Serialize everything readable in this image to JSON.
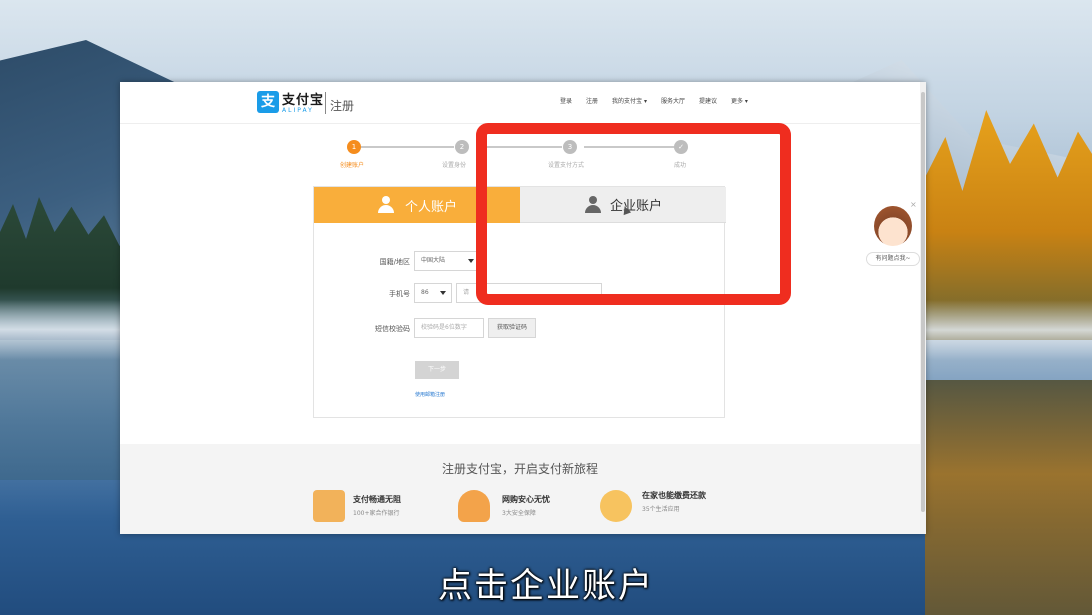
{
  "header": {
    "logo_mark": "支",
    "logo_text": "支付宝",
    "logo_sub": "ALIPAY",
    "page_tag": "注册",
    "nav": [
      "登录",
      "注册",
      "我的支付宝 ▾",
      "服务大厅",
      "提建议",
      "更多 ▾"
    ]
  },
  "steps": [
    {
      "number": "1",
      "label": "创建账户",
      "active": true
    },
    {
      "number": "2",
      "label": "设置身份",
      "active": false
    },
    {
      "number": "3",
      "label": "设置支付方式",
      "active": false
    },
    {
      "number": "✓",
      "label": "成功",
      "active": false
    }
  ],
  "tabs": {
    "personal": "个人账户",
    "business": "企业账户"
  },
  "form": {
    "region_label": "国籍/地区",
    "region_value": "中国大陆",
    "phone_label": "手机号",
    "phone_code": "86",
    "phone_placeholder": "请",
    "sms_label": "短信校验码",
    "sms_placeholder": "校验码是6位数字",
    "sms_button": "获取验证码",
    "next_button": "下一步",
    "email_link": "使用邮箱注册"
  },
  "promo": {
    "title": "注册支付宝，开启支付新旅程",
    "items": [
      {
        "title": "支付畅通无阻",
        "subtitle": "100+家合作银行",
        "color": "#f2b25a"
      },
      {
        "title": "网购安心无忧",
        "subtitle": "3大安全保障",
        "color": "#f3a34a"
      },
      {
        "title": "在家也能缴费还款",
        "subtitle": "35个生活应用",
        "color": "#f7c35f"
      }
    ]
  },
  "helper": {
    "label": "有问题点我~",
    "close": "×"
  },
  "caption": "点击企业账户",
  "colors": {
    "accent": "#f9ae3b",
    "highlight": "#ef2d1f",
    "brand": "#1a9ce8"
  }
}
